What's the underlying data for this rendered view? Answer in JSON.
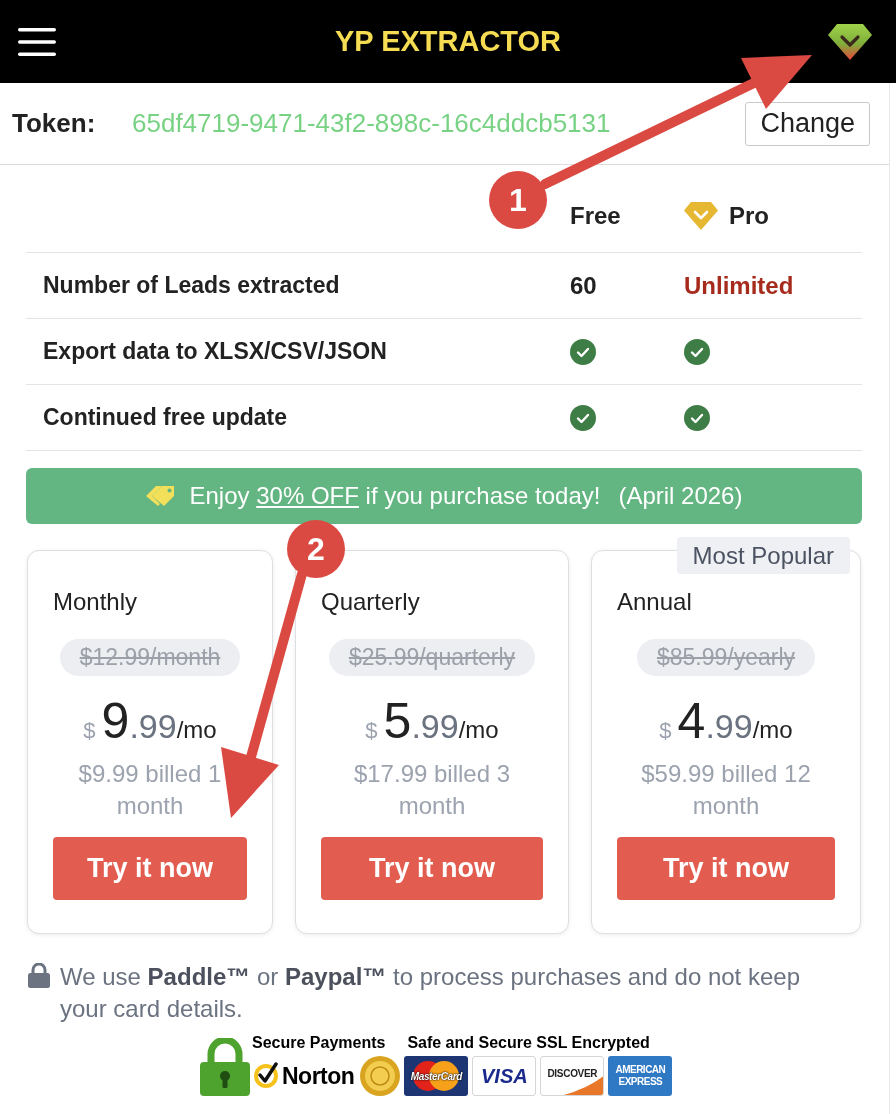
{
  "header": {
    "title": "YP EXTRACTOR"
  },
  "token": {
    "label": "Token:",
    "value": "65df4719-9471-43f2-898c-16c4ddcb5131",
    "button": "Change"
  },
  "comparison": {
    "columns": [
      {
        "label": "Free",
        "kind": "free"
      },
      {
        "label": "Pro",
        "kind": "pro"
      }
    ],
    "rows": [
      {
        "feature": "Number of Leads extracted",
        "cells": [
          {
            "kind": "value",
            "text": "60"
          },
          {
            "kind": "highlight",
            "text": "Unlimited"
          }
        ]
      },
      {
        "feature": "Export data to XLSX/CSV/JSON",
        "cells": [
          {
            "kind": "check"
          },
          {
            "kind": "check"
          }
        ]
      },
      {
        "feature": "Continued free update",
        "cells": [
          {
            "kind": "check"
          },
          {
            "kind": "check"
          }
        ]
      }
    ]
  },
  "promo": {
    "lead": "Enjoy",
    "discount": "30% OFF",
    "tail": "if you purchase today!",
    "date": "(April 2026)"
  },
  "plans": [
    {
      "name": "Monthly",
      "old_price": "$12.99/month",
      "currency": "$",
      "price_whole": "9",
      "price_decimal": ".99",
      "period": "/mo",
      "billed": "$9.99 billed 1 month",
      "button": "Try it now"
    },
    {
      "name": "Quarterly",
      "old_price": "$25.99/quarterly",
      "currency": "$",
      "price_whole": "5",
      "price_decimal": ".99",
      "period": "/mo",
      "billed": "$17.99 billed 3 month",
      "button": "Try it now"
    },
    {
      "name": "Annual",
      "badge": "Most Popular",
      "old_price": "$85.99/yearly",
      "currency": "$",
      "price_whole": "4",
      "price_decimal": ".99",
      "period": "/mo",
      "billed": "$59.99 billed 12 month",
      "button": "Try it now"
    }
  ],
  "security_note": "We use **Paddle™** or **Paypal™** to process purchases and do not keep your card details.",
  "trust_badges": {
    "secure_payments": "Secure Payments",
    "norton": "Norton",
    "ssl": "Safe and Secure SSL Encrypted",
    "cards": [
      {
        "kind": "mastercard",
        "label": "MasterCard"
      },
      {
        "kind": "visa",
        "label": "VISA"
      },
      {
        "kind": "discover",
        "label": "DISCOVER"
      },
      {
        "kind": "amex",
        "label": "AMERICAN EXPRESS"
      }
    ]
  },
  "annotations": [
    {
      "number": "1"
    },
    {
      "number": "2"
    }
  ]
}
